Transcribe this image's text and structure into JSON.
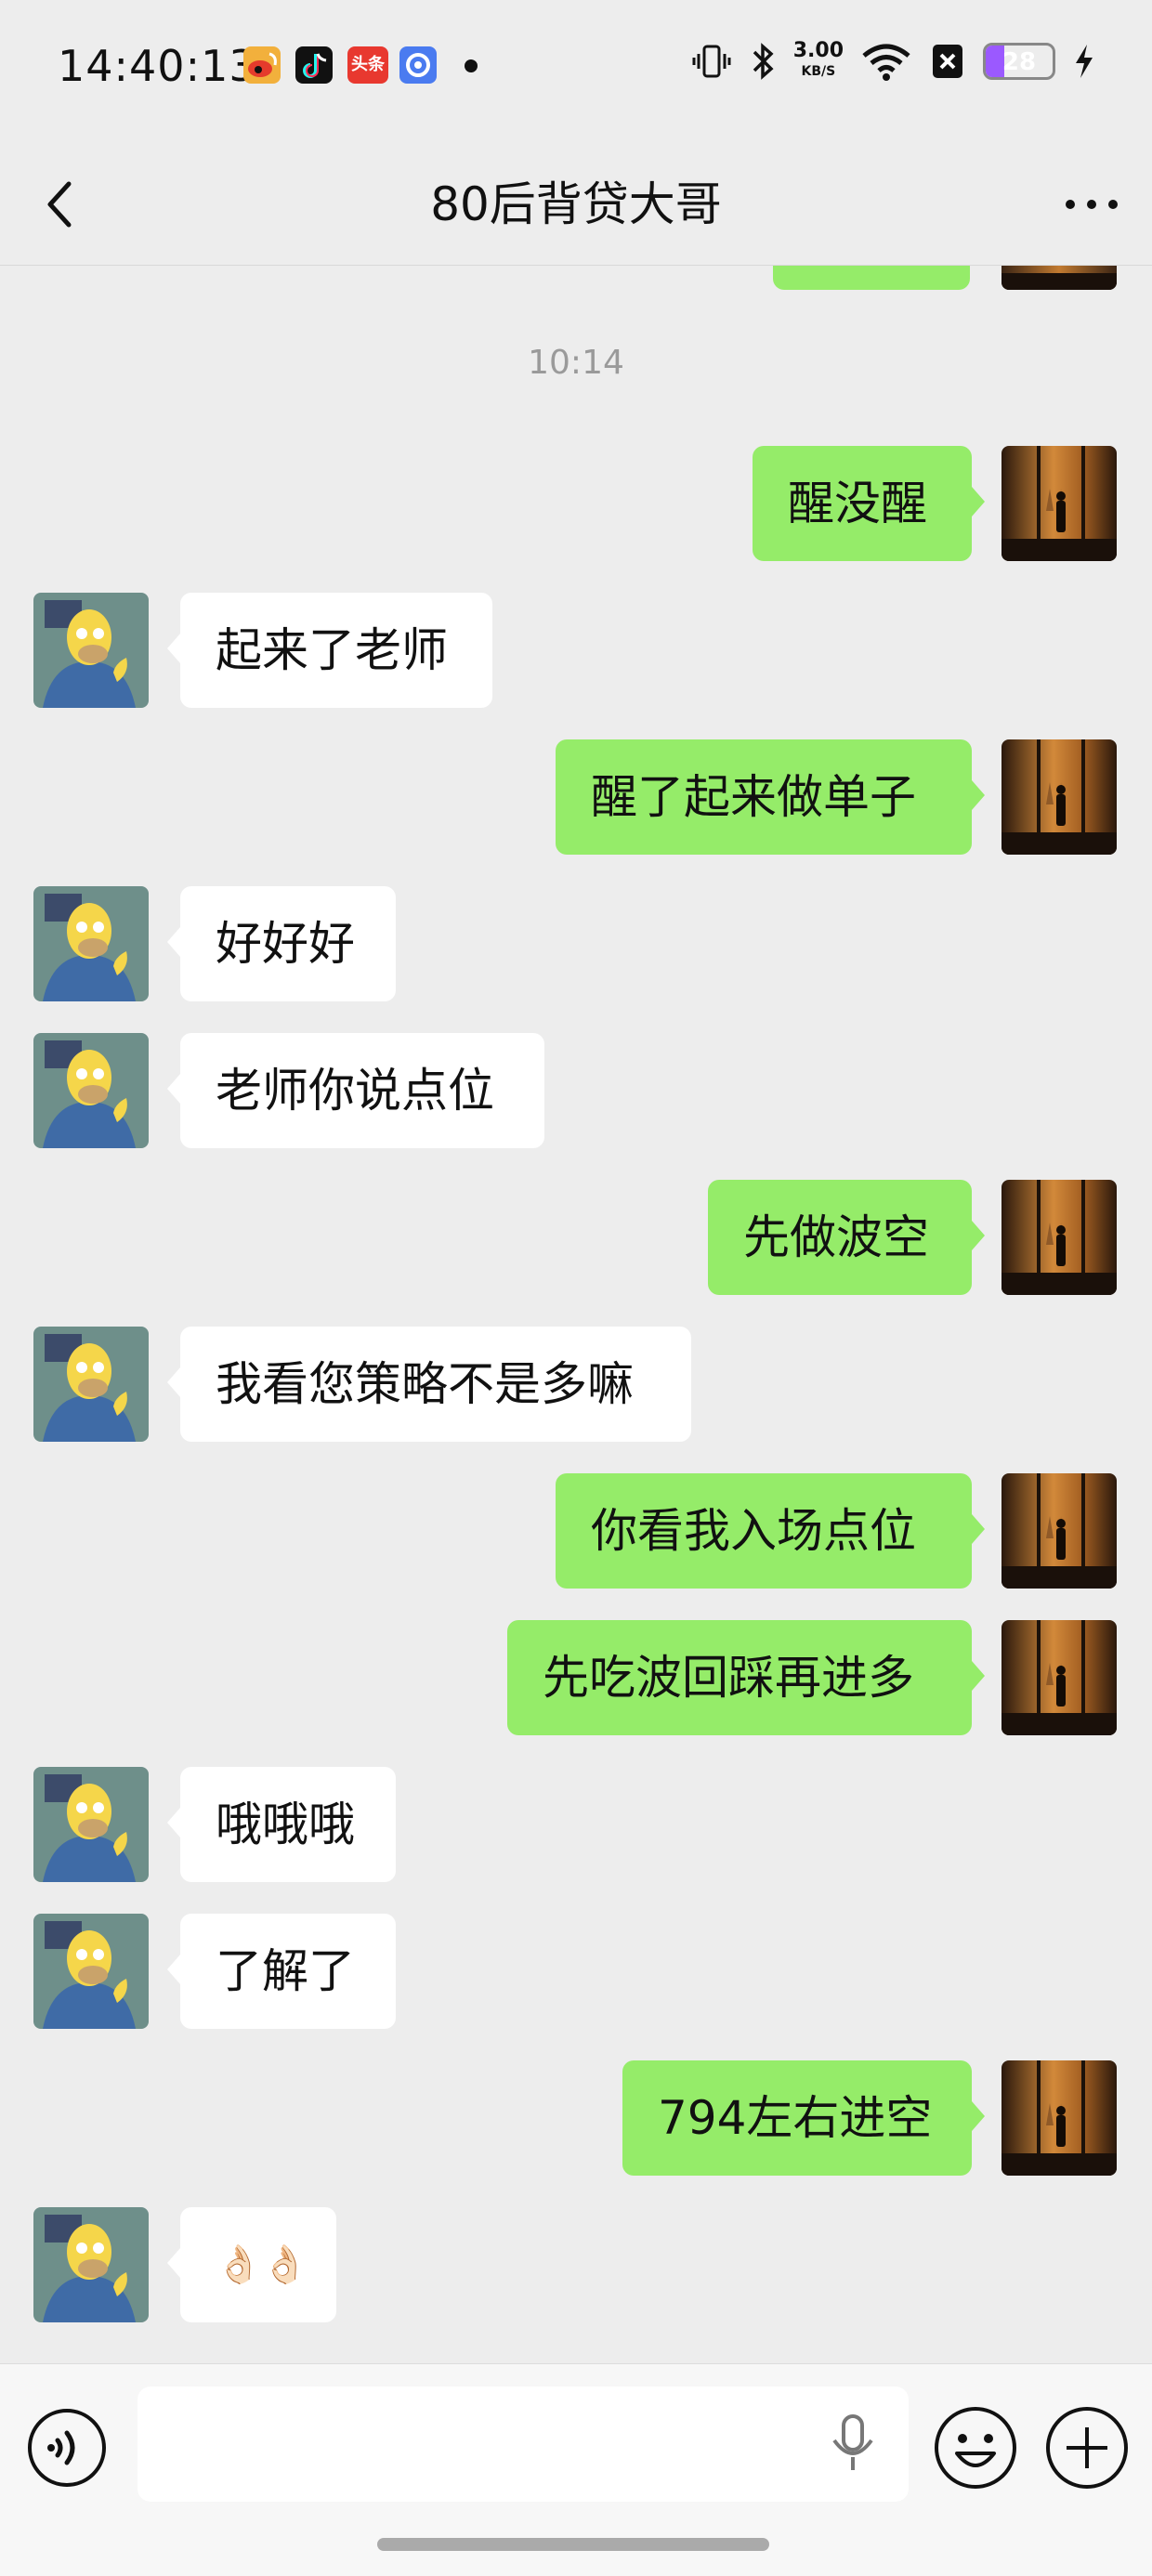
{
  "status_bar": {
    "time": "14:40:13",
    "app_icons": [
      "weibo-icon",
      "tiktok-icon",
      "toutiao-icon",
      "browser-icon"
    ],
    "toutiao_label": "头条",
    "net_speed_value": "3.00",
    "net_speed_unit": "KB/S",
    "battery_level": "28",
    "battery_fraction": 0.28,
    "colors": {
      "battery": "#9b59ff",
      "weibo": "#f2b03c",
      "tiktok": "#111111",
      "toutiao": "#e8382f",
      "browser": "#4a7bf0"
    }
  },
  "header": {
    "title": "80后背贷大哥",
    "back_icon": "chevron-left-icon",
    "more_icon": "more-dots-icon"
  },
  "chat": {
    "timestamp": "10:14",
    "colors": {
      "me_bubble": "#95ec69",
      "them_bubble": "#ffffff",
      "background": "#ededed"
    },
    "messages": [
      {
        "sender": "me",
        "text": "醒没醒"
      },
      {
        "sender": "them",
        "text": "起来了老师"
      },
      {
        "sender": "me",
        "text": "醒了起来做单子"
      },
      {
        "sender": "them",
        "text": "好好好"
      },
      {
        "sender": "them",
        "text": "老师你说点位"
      },
      {
        "sender": "me",
        "text": "先做波空"
      },
      {
        "sender": "them",
        "text": "我看您策略不是多嘛"
      },
      {
        "sender": "me",
        "text": "你看我入场点位"
      },
      {
        "sender": "me",
        "text": "先吃波回踩再进多"
      },
      {
        "sender": "them",
        "text": "哦哦哦"
      },
      {
        "sender": "them",
        "text": "了解了"
      },
      {
        "sender": "me",
        "text": "794左右进空"
      },
      {
        "sender": "them",
        "text": "👌🏻👌🏻"
      }
    ]
  },
  "input_bar": {
    "voice_icon": "voice-mode-icon",
    "mic_icon": "microphone-icon",
    "emoji_icon": "emoji-icon",
    "plus_icon": "plus-icon",
    "input_value": ""
  }
}
